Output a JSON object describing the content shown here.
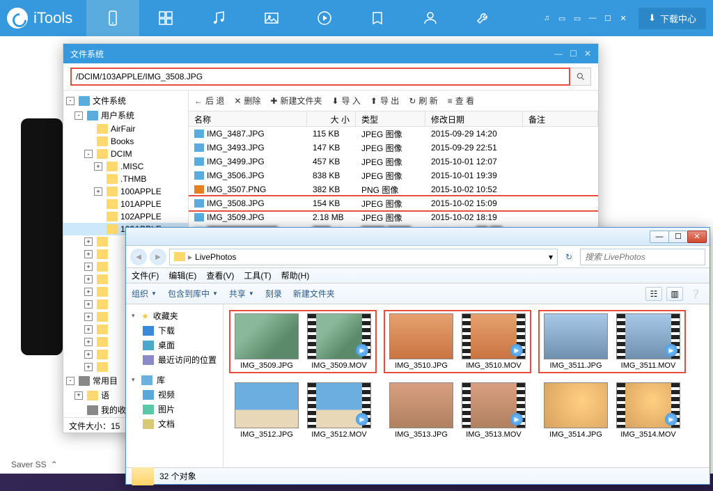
{
  "itools": {
    "brand": "iTools",
    "download_label": "下载中心",
    "bottom_label": "Saver SS"
  },
  "fs": {
    "title": "文件系统",
    "path": "/DCIM/103APPLE/IMG_3508.JPG",
    "toolbar": {
      "back": "后 退",
      "delete": "删除",
      "newfolder": "新建文件夹",
      "import": "导 入",
      "export": "导 出",
      "refresh": "刷 新",
      "view": "查 看"
    },
    "headers": {
      "name": "名称",
      "size": "大 小",
      "type": "类型",
      "date": "修改日期",
      "note": "备注"
    },
    "status": "文件大小：15",
    "tree": [
      {
        "label": "文件系统",
        "indent": 0,
        "exp": "-",
        "icon": "root"
      },
      {
        "label": "用户系统",
        "indent": 1,
        "exp": "-",
        "icon": "root"
      },
      {
        "label": "AirFair",
        "indent": 2,
        "exp": "",
        "icon": "folder"
      },
      {
        "label": "Books",
        "indent": 2,
        "exp": "",
        "icon": "folder"
      },
      {
        "label": "DCIM",
        "indent": 2,
        "exp": "-",
        "icon": "folder"
      },
      {
        "label": ".MISC",
        "indent": 3,
        "exp": "+",
        "icon": "folder"
      },
      {
        "label": ".THMB",
        "indent": 3,
        "exp": "",
        "icon": "folder"
      },
      {
        "label": "100APPLE",
        "indent": 3,
        "exp": "+",
        "icon": "folder"
      },
      {
        "label": "101APPLE",
        "indent": 3,
        "exp": "",
        "icon": "folder"
      },
      {
        "label": "102APPLE",
        "indent": 3,
        "exp": "",
        "icon": "folder"
      },
      {
        "label": "103APPLE",
        "indent": 3,
        "exp": "",
        "icon": "folder",
        "selected": true
      },
      {
        "label": "",
        "indent": 2,
        "exp": "+",
        "icon": "folder"
      },
      {
        "label": "",
        "indent": 2,
        "exp": "+",
        "icon": "folder"
      },
      {
        "label": "",
        "indent": 2,
        "exp": "+",
        "icon": "folder"
      },
      {
        "label": "",
        "indent": 2,
        "exp": "+",
        "icon": "folder"
      },
      {
        "label": "",
        "indent": 2,
        "exp": "+",
        "icon": "folder"
      },
      {
        "label": "",
        "indent": 2,
        "exp": "+",
        "icon": "folder"
      },
      {
        "label": "",
        "indent": 2,
        "exp": "+",
        "icon": "folder"
      },
      {
        "label": "",
        "indent": 2,
        "exp": "+",
        "icon": "folder"
      },
      {
        "label": "",
        "indent": 2,
        "exp": "+",
        "icon": "folder"
      },
      {
        "label": "",
        "indent": 2,
        "exp": "+",
        "icon": "folder"
      },
      {
        "label": "",
        "indent": 2,
        "exp": "+",
        "icon": "folder"
      },
      {
        "label": "常用目",
        "indent": 0,
        "exp": "-",
        "icon": "fav"
      },
      {
        "label": "语",
        "indent": 1,
        "exp": "+",
        "icon": "folder"
      },
      {
        "label": "我的收",
        "indent": 1,
        "exp": "",
        "icon": "fav"
      }
    ],
    "rows": [
      {
        "name": "IMG_3487.JPG",
        "size": "115 KB",
        "type": "JPEG 图像",
        "date": "2015-09-29 14:20",
        "icon": "jpg"
      },
      {
        "name": "IMG_3493.JPG",
        "size": "147 KB",
        "type": "JPEG 图像",
        "date": "2015-09-29 22:51",
        "icon": "jpg"
      },
      {
        "name": "IMG_3499.JPG",
        "size": "457 KB",
        "type": "JPEG 图像",
        "date": "2015-10-01 12:07",
        "icon": "jpg"
      },
      {
        "name": "IMG_3506.JPG",
        "size": "838 KB",
        "type": "JPEG 图像",
        "date": "2015-10-01 19:39",
        "icon": "jpg"
      },
      {
        "name": "IMG_3507.PNG",
        "size": "382 KB",
        "type": "PNG 图像",
        "date": "2015-10-02 10:52",
        "icon": "png"
      },
      {
        "name": "IMG_3508.JPG",
        "size": "154 KB",
        "type": "JPEG 图像",
        "date": "2015-10-02 15:09",
        "icon": "jpg",
        "highlight": true
      },
      {
        "name": "IMG_3509.JPG",
        "size": "2.18 MB",
        "type": "JPEG 图像",
        "date": "2015-10-02 18:19",
        "icon": "jpg"
      }
    ]
  },
  "explorer": {
    "breadcrumb": "LivePhotos",
    "search_placeholder": "搜索 LivePhotos",
    "menu": {
      "file": "文件(F)",
      "edit": "编辑(E)",
      "view": "查看(V)",
      "tools": "工具(T)",
      "help": "帮助(H)"
    },
    "toolbar": {
      "organize": "组织",
      "include": "包含到库中",
      "share": "共享",
      "burn": "刻录",
      "newfolder": "新建文件夹"
    },
    "side": {
      "fav": "收藏夹",
      "download": "下载",
      "desktop": "桌面",
      "recent": "最近访问的位置",
      "lib": "库",
      "video": "视频",
      "picture": "图片",
      "doc": "文档"
    },
    "thumbs": [
      [
        {
          "style": "jpg",
          "label": "IMG_3509.JPG",
          "type": "jpg"
        },
        {
          "style": "jpg",
          "label": "IMG_3509.MOV",
          "type": "mov"
        },
        {
          "style": "orange",
          "label": "IMG_3510.JPG",
          "type": "jpg"
        },
        {
          "style": "orange",
          "label": "IMG_3510.MOV",
          "type": "mov"
        },
        {
          "style": "sky",
          "label": "IMG_3511.JPG",
          "type": "jpg"
        },
        {
          "style": "sky",
          "label": "IMG_3511.MOV",
          "type": "mov"
        }
      ],
      [
        {
          "style": "beach",
          "label": "IMG_3512.JPG",
          "type": "jpg"
        },
        {
          "style": "beach",
          "label": "IMG_3512.MOV",
          "type": "mov"
        },
        {
          "style": "kid",
          "label": "IMG_3513.JPG",
          "type": "jpg"
        },
        {
          "style": "kid",
          "label": "IMG_3513.MOV",
          "type": "mov"
        },
        {
          "style": "sun",
          "label": "IMG_3514.JPG",
          "type": "jpg"
        },
        {
          "style": "sun",
          "label": "IMG_3514.MOV",
          "type": "mov"
        }
      ]
    ],
    "status": "32 个对象"
  }
}
